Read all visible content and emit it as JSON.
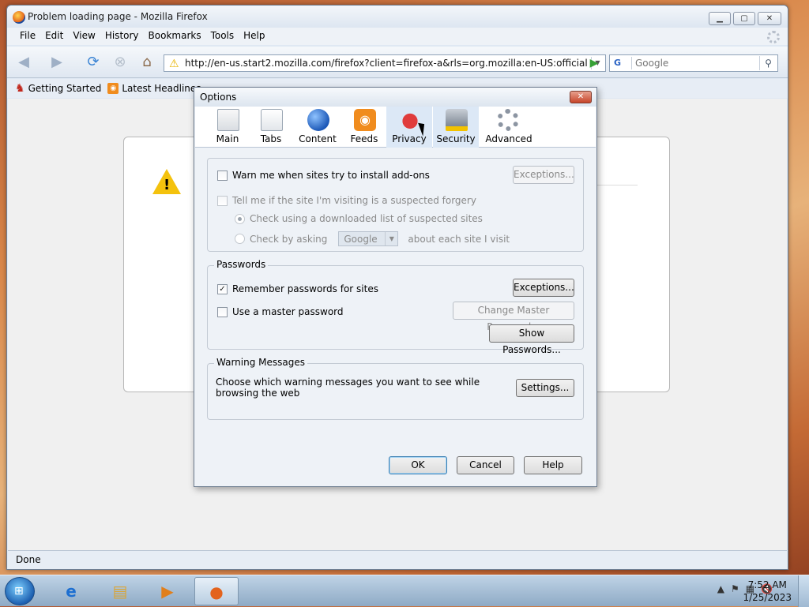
{
  "window": {
    "title": "Problem loading page - Mozilla Firefox",
    "controls": {
      "minimize": "▁",
      "maximize": "▢",
      "close": "✕"
    }
  },
  "menu": {
    "file": "File",
    "edit": "Edit",
    "view": "View",
    "history": "History",
    "bookmarks": "Bookmarks",
    "tools": "Tools",
    "help": "Help"
  },
  "nav": {
    "url": "http://en-us.start2.mozilla.com/firefox?client=firefox-a&rls=org.mozilla:en-US:official",
    "search_engine": "G",
    "search_placeholder": "Google"
  },
  "bookmarks_bar": {
    "item1": "Getting Started",
    "item2": "Latest Headlines"
  },
  "status": {
    "text": "Done"
  },
  "dialog": {
    "title": "Options",
    "close": "✕",
    "panes": [
      "Main",
      "Tabs",
      "Content",
      "Feeds",
      "Privacy",
      "Security",
      "Advanced"
    ],
    "selected_pane": "Privacy",
    "security": {
      "warn_addons": "Warn me when sites try to install add-ons",
      "warn_addons_checked": false,
      "exceptions1": "Exceptions...",
      "forgery": "Tell me if the site I'm visiting is a suspected forgery",
      "forgery_checked": false,
      "check_list": "Check using a downloaded list of suspected sites",
      "check_asking": "Check by asking",
      "engine_select": "Google",
      "about_each": "about each site I visit"
    },
    "passwords": {
      "caption": "Passwords",
      "remember": "Remember passwords for sites",
      "remember_checked": true,
      "exceptions2": "Exceptions...",
      "master": "Use a master password",
      "master_checked": false,
      "change_master": "Change Master Password...",
      "show": "Show Passwords..."
    },
    "warnings": {
      "caption": "Warning Messages",
      "desc": "Choose which warning messages you want to see while browsing the web",
      "settings": "Settings..."
    },
    "buttons": {
      "ok": "OK",
      "cancel": "Cancel",
      "help": "Help"
    }
  },
  "taskbar": {
    "time": "7:52 AM",
    "date": "1/25/2023"
  }
}
